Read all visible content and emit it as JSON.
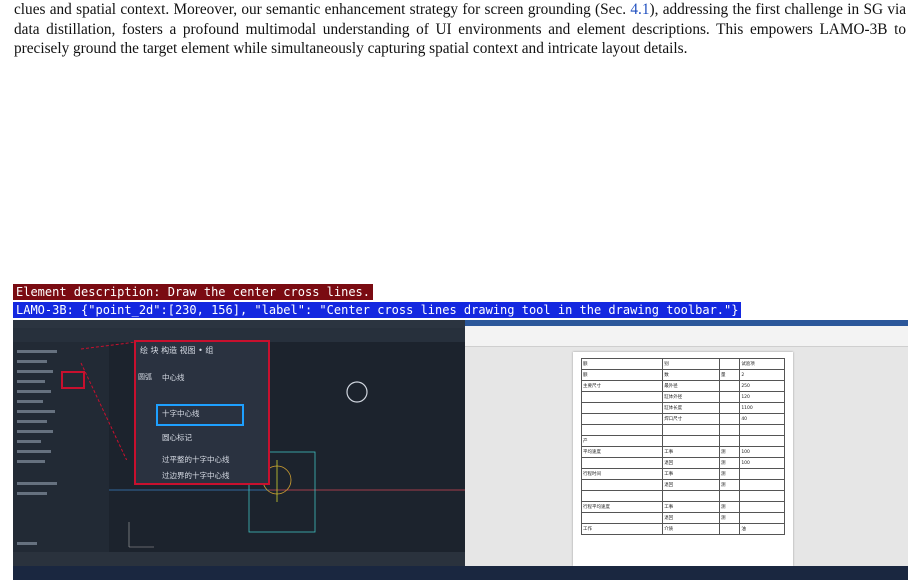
{
  "paragraph": {
    "line1": "clues and spatial context. Moreover, our semantic enhancement strategy for screen grounding (Sec. ",
    "ref": "4.1",
    "line1b": "), addressing the first challenge in SG via data distillation, fosters a profound multimodal understanding of UI environments and element descriptions. This empowers LAMO-3B to precisely ground the target element while simultaneously capturing spatial context and intricate layout details."
  },
  "captions": {
    "element_description": "Element description: Draw the center cross lines.",
    "model_output": "LAMO-3B: {\"point_2d\":[230, 156], \"label\": \"Center cross lines drawing tool in the drawing toolbar.\"}"
  },
  "cad_popup": {
    "header": "绘 块 构造 视图 • 组",
    "items": [
      "中心线",
      "十字中心线",
      "圆心标记",
      "过平整的十字中心线",
      "过边界的十字中心线"
    ],
    "side_label": "圆弧"
  },
  "document_table": {
    "rows": [
      [
        "额",
        "别",
        "",
        "试验项"
      ],
      [
        "额",
        "数",
        "量",
        "2"
      ],
      [
        "主要尺寸",
        "最外径",
        "",
        "250"
      ],
      [
        "",
        "缸体外径",
        "",
        "120"
      ],
      [
        "",
        "缸体长度",
        "",
        "1100"
      ],
      [
        "",
        "焊口尺寸",
        "",
        "40"
      ],
      [
        "",
        "",
        "",
        ""
      ],
      [
        "产",
        "",
        "",
        ""
      ],
      [
        "平均速度",
        "工事",
        "测",
        "100"
      ],
      [
        "",
        "退回",
        "测",
        "100"
      ],
      [
        "行程时间",
        "工事",
        "测",
        ""
      ],
      [
        "",
        "退回",
        "测",
        ""
      ],
      [
        "",
        "",
        "",
        ""
      ],
      [
        "行程平均速度",
        "工事",
        "测",
        ""
      ],
      [
        "",
        "退回",
        "测",
        ""
      ],
      [
        "工作",
        "介质",
        "",
        "油"
      ]
    ]
  },
  "colors": {
    "caption1_bg": "#7a0b12",
    "caption2_bg": "#1428e0",
    "highlight_red": "#c8102e",
    "highlight_blue": "#1ea0ff"
  }
}
